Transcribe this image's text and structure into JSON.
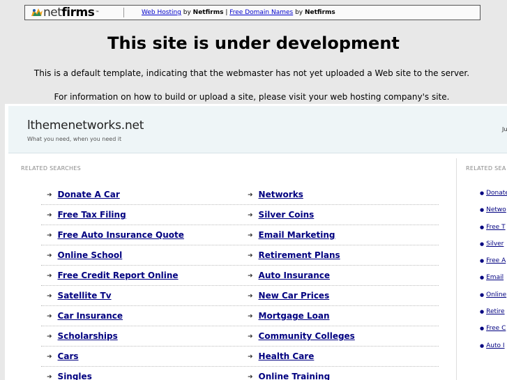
{
  "topbar": {
    "logo_net": "net",
    "logo_firms": "firms",
    "logo_tm": "™",
    "link1": "Web Hosting",
    "by1": " by ",
    "brand1": "Netfirms",
    "pipe": " | ",
    "link2": "Free Domain Names",
    "by2": " by ",
    "brand2": "Netfirms"
  },
  "headline": "This site is under development",
  "para1": "This is a default template, indicating that the webmaster has not yet uploaded a Web site to the server.",
  "para2": "For information on how to build or upload a site, please visit your web hosting company's site.",
  "parked": {
    "site_title": "lthemenetworks.net",
    "tagline": "What you need, when you need it",
    "header_right": "Ju",
    "related_label": "RELATED SEARCHES",
    "related_label_right": "RELATED SEA",
    "left_links": [
      "Donate A Car",
      "Free Tax Filing",
      "Free Auto Insurance Quote",
      "Online School",
      "Free Credit Report Online",
      "Satellite Tv",
      "Car Insurance",
      "Scholarships",
      "Cars",
      "Singles"
    ],
    "right_links": [
      "Networks",
      "Silver Coins",
      "Email Marketing",
      "Retirement Plans",
      "Auto Insurance",
      "New Car Prices",
      "Mortgage Loan",
      "Community Colleges",
      "Health Care",
      "Online Training"
    ],
    "side_links": [
      "Donate",
      "Netwo",
      "Free T",
      "Silver",
      "Free A",
      "Email",
      "Online",
      "Retire",
      "Free C",
      "Auto I"
    ]
  },
  "colors": {
    "link": "#000080",
    "topbar_link": "#0000cc",
    "header_bg": "#eef5f7",
    "page_bg": "#e8e8e8"
  },
  "icons": {
    "logo": "netfirms-logo-icon",
    "arrow": "arrow-right-icon",
    "bullet": "bullet-icon"
  }
}
